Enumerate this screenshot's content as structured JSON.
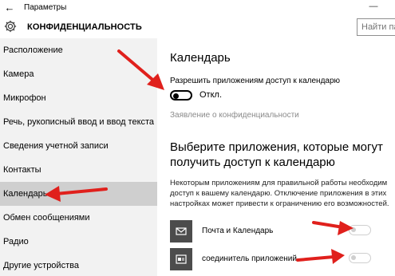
{
  "window": {
    "title": "Параметры",
    "back_icon": "back-arrow-icon",
    "minimize_symbol": "—"
  },
  "header": {
    "section_title": "КОНФИДЕНЦИАЛЬНОСТЬ",
    "search_placeholder": "Найти пар"
  },
  "sidebar": {
    "items": [
      {
        "label": "Расположение"
      },
      {
        "label": "Камера"
      },
      {
        "label": "Микрофон"
      },
      {
        "label": "Речь, рукописный ввод и ввод текста"
      },
      {
        "label": "Сведения учетной записи"
      },
      {
        "label": "Контакты"
      },
      {
        "label": "Календарь",
        "selected": true
      },
      {
        "label": "Обмен сообщениями"
      },
      {
        "label": "Радио"
      },
      {
        "label": "Другие устройства"
      }
    ]
  },
  "content": {
    "heading": "Календарь",
    "allow_label": "Разрешить приложениям доступ к календарю",
    "toggle_state": "Откл.",
    "toggle_on": false,
    "privacy_link": "Заявление о конфиденциальности",
    "choose_heading": "Выберите приложения, которые могут получить доступ к календарю",
    "description": "Некоторым приложениям для правильной работы необходим доступ к вашему календарю. Отключение приложения в этих настройках может привести к ограничению его возможностей.",
    "apps": [
      {
        "name": "Почта и Календарь",
        "icon": "mail-icon",
        "enabled": false
      },
      {
        "name": "соединитель приложений",
        "icon": "app-connector-icon",
        "enabled": false
      }
    ]
  },
  "colors": {
    "sidebar_bg": "#f2f2f2",
    "selected_bg": "#cfcfcf",
    "annotation_arrow": "#e0201c"
  }
}
